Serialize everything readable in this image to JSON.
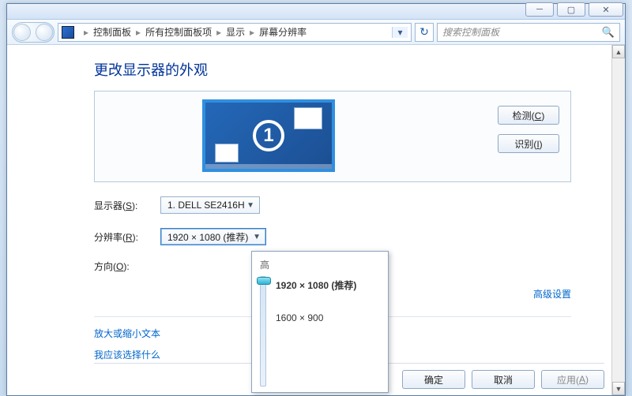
{
  "breadcrumb": {
    "item1": "控制面板",
    "item2": "所有控制面板项",
    "item3": "显示",
    "item4": "屏幕分辨率"
  },
  "search": {
    "placeholder": "搜索控制面板"
  },
  "page": {
    "title": "更改显示器的外观"
  },
  "monitor": {
    "number": "1",
    "detect_btn": "检测(C)",
    "identify_btn": "识别(I)"
  },
  "form": {
    "display_label": "显示器(S):",
    "display_value": "1. DELL SE2416H",
    "resolution_label": "分辨率(R):",
    "resolution_value": "1920 × 1080 (推荐)",
    "orientation_label": "方向(O):"
  },
  "links": {
    "advanced": "高级设置",
    "zoom_text": "放大或缩小文本",
    "help_choose": "我应该选择什么"
  },
  "footer": {
    "ok": "确定",
    "cancel": "取消",
    "apply": "应用(A)"
  },
  "popup": {
    "high_label": "高",
    "opt1": "1920 × 1080 (推荐)",
    "opt2": "1600 × 900"
  }
}
